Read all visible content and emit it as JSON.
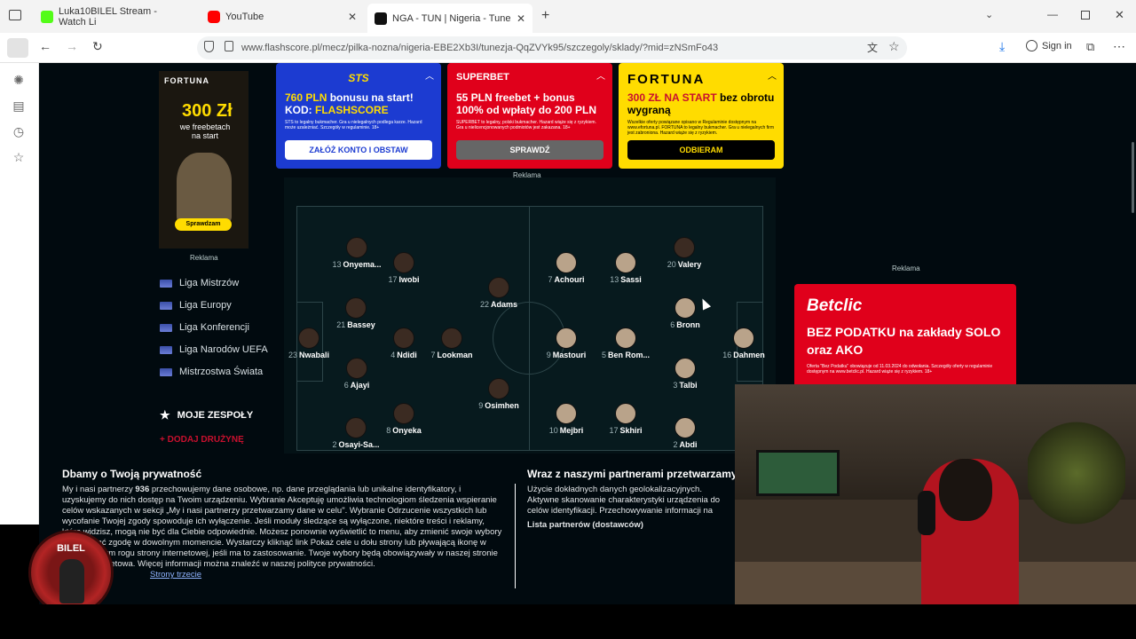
{
  "browser": {
    "tabs": [
      {
        "title": "Luka10BILEL Stream - Watch Li",
        "icon": "kick-icon",
        "color": "#53fc18"
      },
      {
        "title": "YouTube",
        "icon": "youtube-icon",
        "color": "#ff0000"
      },
      {
        "title": "NGA - TUN | Nigeria - Tunezja |",
        "icon": "flashscore-icon",
        "color": "#111111"
      }
    ],
    "url": "www.flashscore.pl/mecz/pilka-nozna/nigeria-EBE2Xb3I/tunezja-QqZVYk95/szczegoly/sklady/?mid=zNSmFo43",
    "sign_in": "Sign in"
  },
  "left_ad": {
    "brand": "FORTUNA",
    "amount": "300 Zł",
    "subtitle": "we freebetach na start",
    "button": "Sprawdzam",
    "label": "Reklama"
  },
  "nav": {
    "items": [
      "Liga Mistrzów",
      "Liga Europy",
      "Liga Konferencji",
      "Liga Narodów UEFA",
      "Mistrzostwa Świata"
    ],
    "my_teams": "MOJE ZESPOŁY",
    "add_team": "+ DODAJ DRUŻYNĘ"
  },
  "top_ads": [
    {
      "brand": "STS",
      "headline_accent": "760 PLN",
      "headline": " bonusu na start!",
      "code_prefix": "KOD: ",
      "code": "FLASHSCORE",
      "fine": "STS to legalny bukmacher. Gra u nielegalnych podlega karze. Hazard może uzależniać. Szczegóły w regulaminie. 18+",
      "button": "ZAŁÓŻ KONTO I OBSTAW",
      "bg": "#1c3bd1"
    },
    {
      "brand": "SUPERBET",
      "headline_accent": "",
      "headline": "55 PLN freebet + bonus 100% od wpłaty do 200 PLN",
      "code_prefix": "",
      "code": "",
      "fine": "SUPERBET to legalny, polski bukmacher. Hazard wiąże się z ryzykiem. Gra u nielicencjonowanych podmiotów jest zakazana. 18+",
      "button": "SPRAWDŹ",
      "bg": "#e0001b"
    },
    {
      "brand": "FORTUNA",
      "headline_accent": "300 ZŁ NA START",
      "headline": " bez obrotu wygraną",
      "code_prefix": "",
      "code": "",
      "fine": "Wszelkie oferty powiązane opisano w Regulaminie dostępnym na www.efortuna.pl. FORTUNA to legalny bukmacher. Gra u nielegalnych firm jest zabroniona. Hazard wiąże się z ryzykiem.",
      "button": "ODBIERAM",
      "bg": "#ffdc00"
    }
  ],
  "ads_label": "Reklama",
  "lineup": {
    "home": [
      {
        "num": "13",
        "name": "Onyema..."
      },
      {
        "num": "17",
        "name": "Iwobi"
      },
      {
        "num": "22",
        "name": "Adams"
      },
      {
        "num": "21",
        "name": "Bassey"
      },
      {
        "num": "23",
        "name": "Nwabali"
      },
      {
        "num": "4",
        "name": "Ndidi"
      },
      {
        "num": "7",
        "name": "Lookman"
      },
      {
        "num": "6",
        "name": "Ajayi"
      },
      {
        "num": "9",
        "name": "Osimhen"
      },
      {
        "num": "8",
        "name": "Onyeka"
      },
      {
        "num": "2",
        "name": "Osayi-Sa..."
      }
    ],
    "away": [
      {
        "num": "7",
        "name": "Achouri"
      },
      {
        "num": "13",
        "name": "Sassi"
      },
      {
        "num": "20",
        "name": "Valery"
      },
      {
        "num": "6",
        "name": "Bronn"
      },
      {
        "num": "9",
        "name": "Mastouri"
      },
      {
        "num": "5",
        "name": "Ben Rom..."
      },
      {
        "num": "16",
        "name": "Dahmen"
      },
      {
        "num": "3",
        "name": "Talbi"
      },
      {
        "num": "10",
        "name": "Mejbri"
      },
      {
        "num": "17",
        "name": "Skhiri"
      },
      {
        "num": "2",
        "name": "Abdi"
      }
    ]
  },
  "right_ad": {
    "label": "Reklama",
    "brand": "Betclic",
    "headline": "BEZ PODATKU na zakłady SOLO oraz AKO",
    "fine": "Oferta \"Bez Podatku\" obowiązuje od 11.03.2024 do odwołania. Szczegóły oferty w regulaminie dostępnym na www.betclic.pl. Hazard wiąże się z ryzykiem. 18+"
  },
  "privacy": {
    "title": "Dbamy o Twoją prywatność",
    "text_1": "My i nasi partnerzy ",
    "partners_count": "936",
    "text_2": " przechowujemy dane osobowe, np. dane przeglądania lub unikalne identyfikatory, i uzyskujemy do nich dostęp na Twoim urządzeniu. Wybranie Akceptuję umożliwia technologiom śledzenia wspieranie celów wskazanych w sekcji „My i nasi partnerzy przetwarzamy dane w celu\". Wybranie Odrzucenie wszystkich lub wycofanie Twojej zgody spowoduje ich wyłączenie. Jeśli moduły śledzące są wyłączone, niektóre treści i reklamy, które widzisz, mogą nie być dla Ciebie odpowiednie. Możesz ponownie wyświetlić to menu, aby zmienić swoje wybory lub wycofać zgodę w dowolnym momencie. Wystarczy kliknąć link Pokaż cele u dołu strony lub pływającą ikonę w lewym dolnym rogu strony internetowej, jeśli ma to zastosowanie. Twoje wybory będą obowiązywały w naszej stronie Strona internetowa. Więcej informacji można znaleźć w naszej polityce prywatności.",
    "link": "Strony trzecie",
    "right_title": "Wraz z naszymi partnerami przetwarzamy dane w celu",
    "right_text": "Użycie dokładnych danych geolokalizacyjnych. Aktywne skanowanie charakterystyki urządzenia do celów identyfikacji. Przechowywanie informacji na urządzeniu lub dostęp do nich. Spersonalizowane reklamy i treści, pomiar reklam i treści, badanie odbiorców i rozwój usług.",
    "partners_link": "Lista partnerów (dostawców)"
  },
  "overlay": {
    "channel_logo_text": "BILEL"
  }
}
